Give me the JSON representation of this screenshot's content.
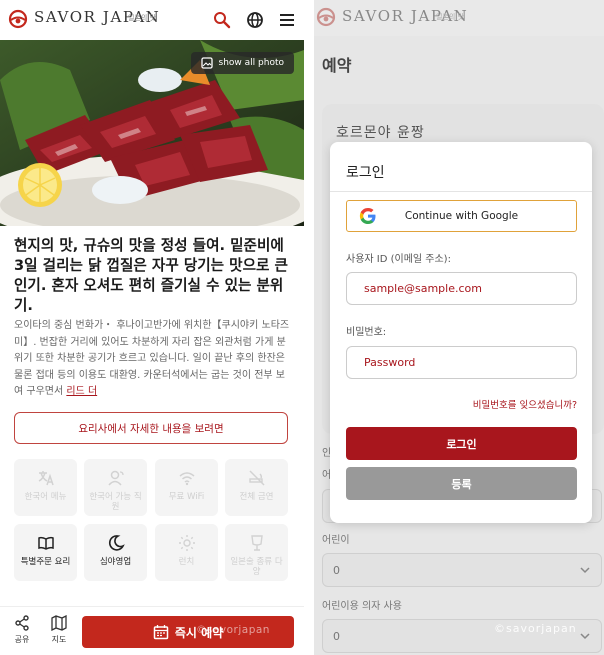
{
  "left": {
    "header": {
      "logo_text": "SAVOR JAPAN",
      "logo_sub": "일본의 맛",
      "icons": [
        "search-icon",
        "globe-icon",
        "menu-icon"
      ]
    },
    "hero": {
      "show_all_photo": "show all photo"
    },
    "restaurant": {
      "title": "현지의 맛, 규슈의 맛을 정성 들여. 밑준비에 3일 걸리는 닭 껍질은 자꾸 당기는 맛으로 큰 인기. 혼자 오셔도 편히 즐기실 수 있는 분위기.",
      "description": "오이타의 중심 번화가・ 후나이고반가에 위치한【쿠시야키 노타즈미】. 번잡한 거리에 있어도 차분하게 자리 잡은 외관처럼 가게 분위기 또한 차분한 공기가 흐르고 있습니다. 일이 끝난 후의 한잔은 물론 접대 등의 이용도 대환영. 카운터석에서는 굽는 것이 전부 보여 구우면서 ",
      "read_more": "리드 더"
    },
    "detail_button": "요리사에서 자세한 내용을 보려면",
    "features": [
      {
        "icon": "translate-icon",
        "label": "한국어 메뉴",
        "active": false
      },
      {
        "icon": "staff-icon",
        "label": "한국어 가능 직원",
        "active": false
      },
      {
        "icon": "wifi-icon",
        "label": "무료 WiFi",
        "active": false
      },
      {
        "icon": "no-smoking-icon",
        "label": "전체 금연",
        "active": false
      },
      {
        "icon": "book-icon",
        "label": "특별주문 요리",
        "active": true
      },
      {
        "icon": "moon-icon",
        "label": "심야영업",
        "active": true
      },
      {
        "icon": "sun-icon",
        "label": "런치",
        "active": false
      },
      {
        "icon": "drink-icon",
        "label": "일본술 종류 다양",
        "active": false
      }
    ],
    "bottom_bar": {
      "share_label": "공유",
      "map_label": "지도",
      "reserve_label": "즉시 예약",
      "watermark": "©savorjapan"
    }
  },
  "right": {
    "header": {
      "logo_text": "SAVOR JAPAN",
      "logo_sub": "일본의 맛"
    },
    "page_title": "예약",
    "store_name": "호르몬야 윤짱",
    "form": {
      "section_label_partial": "인",
      "adult_label_partial": "어",
      "child_label": "어린이",
      "child_value": "0",
      "child_seat_label": "어린이용 의자 사용",
      "child_seat_value": "0"
    },
    "watermark": "©savorjapan",
    "login_modal": {
      "title": "로그인",
      "google_button": "Continue with Google",
      "user_id_label": "사용자 ID (이메일 주소):",
      "user_id_placeholder": "sample@sample.com",
      "password_label": "비밀번호:",
      "password_placeholder": "Password",
      "forgot_password": "비밀번호를 잊으셨습니까?",
      "login_button": "로그인",
      "register_button": "등록"
    }
  },
  "colors": {
    "accent_red": "#a8161d",
    "reserve_red": "#c3281d",
    "google_border": "#e0a23a"
  }
}
